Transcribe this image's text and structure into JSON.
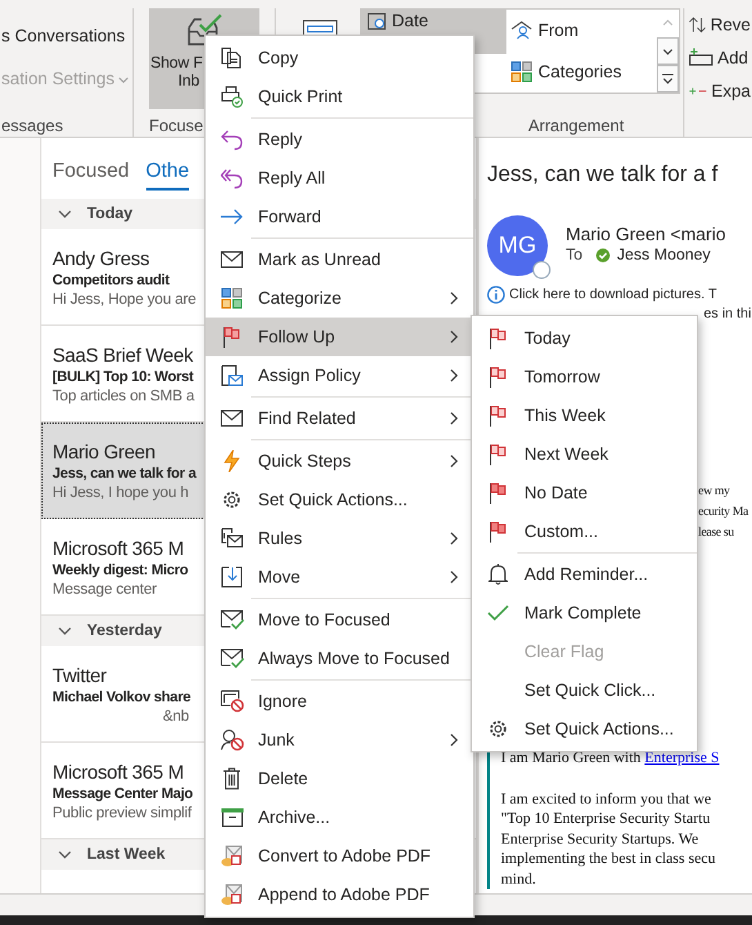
{
  "ribbon": {
    "groups": [
      {
        "kind": "conversations",
        "items": [
          "s Conversations",
          "sation Settings"
        ],
        "label": "essages"
      },
      {
        "kind": "focused",
        "button": [
          "Show F",
          "Inb"
        ],
        "label": "Focuse"
      },
      {
        "kind": "arrangement",
        "gallery": [
          {
            "label": "Date",
            "selected": true
          },
          {
            "label": "From",
            "selected": false
          },
          {
            "label": "Categories",
            "selected": false
          }
        ],
        "label": "Arrangement"
      },
      {
        "kind": "actions",
        "items": [
          "Reve",
          "Add",
          "Expa"
        ]
      }
    ]
  },
  "message_list": {
    "tabs": [
      {
        "label": "Focused",
        "selected": false
      },
      {
        "label": "Othe",
        "selected": true
      }
    ],
    "groups": [
      {
        "label": "Today",
        "messages": [
          {
            "sender": "Andy Gress",
            "subject": "Competitors audit",
            "preview": "Hi Jess, Hope you are",
            "selected": false
          },
          {
            "sender": "SaaS Brief Week",
            "subject": "[BULK] Top 10: Worst",
            "preview": "Top articles on SMB a",
            "selected": false
          },
          {
            "sender": "Mario Green",
            "subject": "Jess, can we talk for a",
            "preview": "Hi Jess,  I hope you h",
            "selected": true
          },
          {
            "sender": "Microsoft 365 M",
            "subject": "Weekly digest: Micro",
            "preview": "Message center",
            "selected": false
          }
        ]
      },
      {
        "label": "Yesterday",
        "messages": [
          {
            "sender": "Twitter",
            "subject": "Michael Volkov share",
            "preview": "&nb",
            "selected": false
          },
          {
            "sender": "Microsoft 365 M",
            "subject": "Message Center Majo",
            "preview": "Public preview simplif",
            "selected": false
          }
        ]
      },
      {
        "label": "Last Week"
      }
    ]
  },
  "reading_pane": {
    "subject": "Jess, can we talk for a f",
    "avatar": "MG",
    "from": "Mario Green <mario",
    "to_label": "To",
    "to": "Jess Mooney",
    "info": [
      "Click here to download pictures. T",
      "es in thi"
    ],
    "fragments": [
      "ew my",
      "ecurity Ma",
      "lease su"
    ],
    "intro": "I am Mario Green with ",
    "link": "Enterprise S",
    "paragraph": [
      "I am excited to inform you that we",
      "\"Top 10 Enterprise Security Startu",
      "Enterprise  Security  Startups. We",
      "implementing the best in class secu",
      "mind."
    ]
  },
  "context_menu": {
    "sections": [
      [
        {
          "label": "Copy",
          "kind": "copy",
          "submenu": false,
          "highlighted": false
        },
        {
          "label": "Quick Print",
          "kind": "print",
          "submenu": false,
          "highlighted": false
        }
      ],
      [
        {
          "label": "Reply",
          "kind": "reply",
          "submenu": false,
          "highlighted": false
        },
        {
          "label": "Reply All",
          "kind": "replyall",
          "submenu": false,
          "highlighted": false
        },
        {
          "label": "Forward",
          "kind": "forward",
          "submenu": false,
          "highlighted": false
        }
      ],
      [
        {
          "label": "Mark as Unread",
          "kind": "envelope",
          "submenu": false,
          "highlighted": false
        },
        {
          "label": "Categorize",
          "kind": "categories",
          "submenu": true,
          "highlighted": false
        },
        {
          "label": "Follow Up",
          "kind": "flag",
          "submenu": true,
          "highlighted": true
        },
        {
          "label": "Assign Policy",
          "kind": "policy",
          "submenu": true,
          "highlighted": false
        }
      ],
      [
        {
          "label": "Find Related",
          "kind": "envelope",
          "submenu": true,
          "highlighted": false
        }
      ],
      [
        {
          "label": "Quick Steps",
          "kind": "bolt",
          "submenu": true,
          "highlighted": false
        },
        {
          "label": "Set Quick Actions...",
          "kind": "gear",
          "submenu": false,
          "highlighted": false
        },
        {
          "label": "Rules",
          "kind": "rules",
          "submenu": true,
          "highlighted": false
        },
        {
          "label": "Move",
          "kind": "move",
          "submenu": true,
          "highlighted": false
        }
      ],
      [
        {
          "label": "Move to Focused",
          "kind": "focused",
          "submenu": false,
          "highlighted": false
        },
        {
          "label": "Always Move to Focused",
          "kind": "focused",
          "submenu": false,
          "highlighted": false
        }
      ],
      [
        {
          "label": "Ignore",
          "kind": "ignore",
          "submenu": false,
          "highlighted": false
        },
        {
          "label": "Junk",
          "kind": "junk",
          "submenu": true,
          "highlighted": false
        },
        {
          "label": "Delete",
          "kind": "delete",
          "submenu": false,
          "highlighted": false
        },
        {
          "label": "Archive...",
          "kind": "archive",
          "submenu": false,
          "highlighted": false
        },
        {
          "label": "Convert to Adobe PDF",
          "kind": "pdf",
          "submenu": false,
          "highlighted": false
        },
        {
          "label": "Append to Adobe PDF",
          "kind": "pdf",
          "submenu": false,
          "highlighted": false
        }
      ]
    ]
  },
  "follow_up_menu": {
    "sections": [
      [
        {
          "label": "Today",
          "kind": "flag",
          "disabled": false
        },
        {
          "label": "Tomorrow",
          "kind": "flag",
          "disabled": false
        },
        {
          "label": "This Week",
          "kind": "flag",
          "disabled": false
        },
        {
          "label": "Next Week",
          "kind": "flag",
          "disabled": false
        },
        {
          "label": "No Date",
          "kind": "flag",
          "disabled": false
        },
        {
          "label": "Custom...",
          "kind": "flag",
          "disabled": false
        }
      ],
      [
        {
          "label": "Add Reminder...",
          "kind": "bell",
          "disabled": false
        },
        {
          "label": "Mark Complete",
          "kind": "check",
          "disabled": false
        },
        {
          "label": "Clear Flag",
          "kind": "none",
          "disabled": true
        },
        {
          "label": "Set Quick Click...",
          "kind": "none",
          "disabled": false
        },
        {
          "label": "Set Quick Actions...",
          "kind": "gear",
          "disabled": false
        }
      ]
    ]
  }
}
